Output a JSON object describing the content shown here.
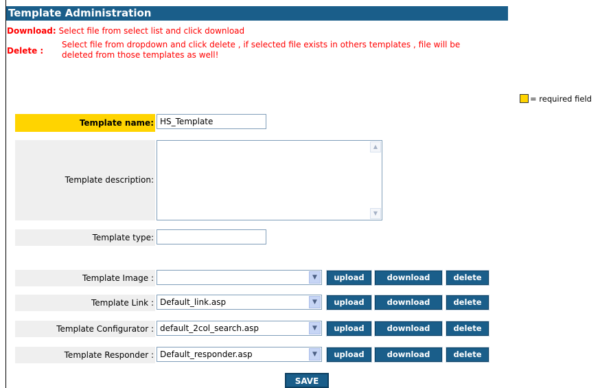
{
  "header": {
    "title": "Template Administration"
  },
  "instructions": {
    "download_label": "Download:",
    "download_text": "Select file from select list and click download",
    "delete_label": "Delete :",
    "delete_text_line1": "Select file from dropdown and click delete , if selected file exists in others templates , file will be",
    "delete_text_line2": "deleted from those templates as well!"
  },
  "legend": {
    "text": "= required field"
  },
  "form": {
    "name_label": "Template name:",
    "name_value": "HS_Template",
    "description_label": "Template description:",
    "description_value": "",
    "type_label": "Template type:",
    "type_value": ""
  },
  "file_rows": [
    {
      "label": "Template Image :",
      "selected": ""
    },
    {
      "label": "Template Link :",
      "selected": "Default_link.asp"
    },
    {
      "label": "Template Configurator :",
      "selected": "default_2col_search.asp"
    },
    {
      "label": "Template Responder :",
      "selected": "Default_responder.asp"
    }
  ],
  "buttons": {
    "upload": "upload",
    "download": "download",
    "delete": "delete",
    "save": "SAVE"
  },
  "colors": {
    "header_bg": "#1a5e8a",
    "required": "#ffd400",
    "instruction_text": "#ff0000"
  }
}
